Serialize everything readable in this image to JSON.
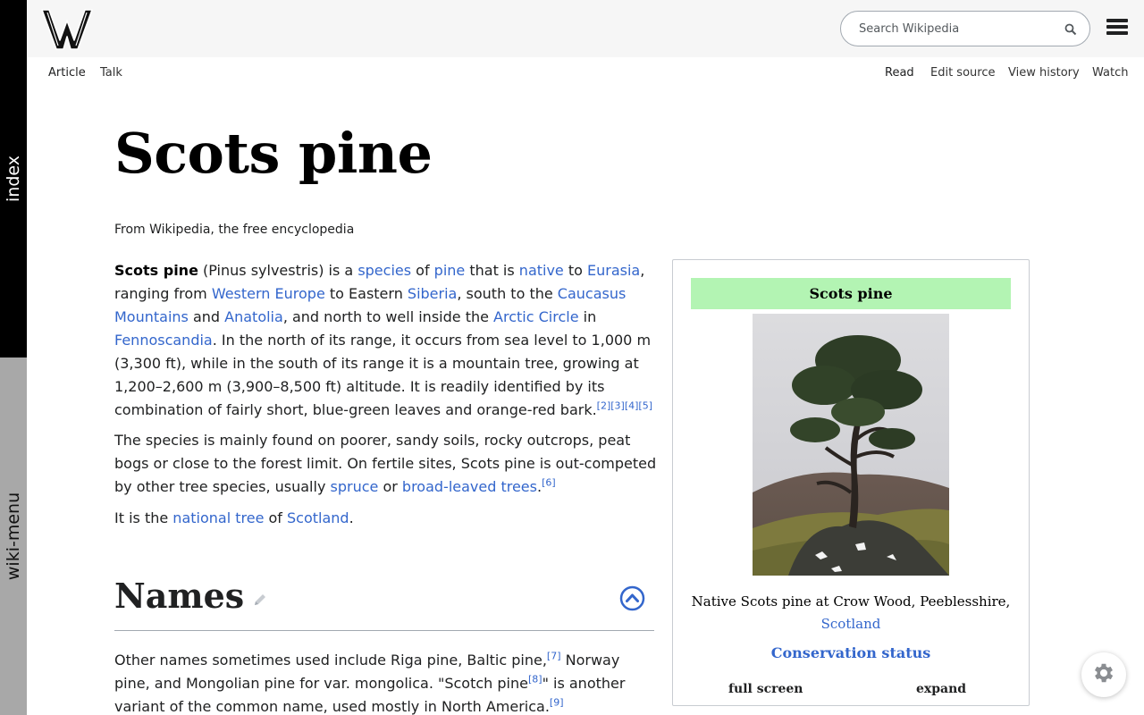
{
  "sidebar": {
    "index_label": "index",
    "menu_label": "wiki-menu"
  },
  "header": {
    "search_placeholder": "Search Wikipedia"
  },
  "tabs": {
    "article": "Article",
    "talk": "Talk",
    "read": "Read",
    "edit_source": "Edit source",
    "view_history": "View history",
    "watch": "Watch"
  },
  "page": {
    "title": "Scots pine",
    "tagline": "From Wikipedia, the free encyclopedia"
  },
  "intro": {
    "p1": {
      "bold": "Scots pine",
      "t1": " (Pinus sylvestris) is a ",
      "l_species": "species",
      "t2": " of ",
      "l_pine": "pine",
      "t3": " that is ",
      "l_native": "native",
      "t4": " to ",
      "l_eurasia": "Eurasia",
      "t5": ", ranging from ",
      "l_western_europe": "Western Europe",
      "t6": " to Eastern ",
      "l_siberia": "Siberia",
      "t7": ", south to the ",
      "l_caucasus": "Caucasus Mountains",
      "t8": " and ",
      "l_anatolia": "Anatolia",
      "t9": ", and north to well inside the ",
      "l_arctic": "Arctic Circle",
      "t10": " in ",
      "l_fennoscandia": "Fennoscandia",
      "t11": ". In the north of its range, it occurs from sea level to 1,000 m (3,300 ft), while in the south of its range it is a mountain tree, growing at 1,200–2,600 m (3,900–8,500 ft) altitude. It is readily identified by its combination of fairly short, blue-green leaves and orange-red bark.",
      "refs": "[2][3][4][5]"
    },
    "p2": {
      "t1": "The species is mainly found on poorer, sandy soils, rocky outcrops, peat bogs or close to the forest limit. On fertile sites, Scots pine is out-competed by other tree species, usually ",
      "l_spruce": "spruce",
      "t2": " or ",
      "l_broad": "broad-leaved trees",
      "t3": ".",
      "ref": "[6]"
    },
    "p3": {
      "t1": "It is the ",
      "l_national_tree": "national tree",
      "t2": " of ",
      "l_scotland": "Scotland",
      "t3": "."
    }
  },
  "names_section": {
    "heading": "Names",
    "t1": "Other names sometimes used include Riga pine, Baltic pine,",
    "ref7": "[7]",
    "t2": " Norway pine, and Mongolian pine for var. mongolica. \"Scotch pine",
    "ref8": "[8]",
    "t3": "\" is another variant of the common name, used mostly in North America.",
    "ref9": "[9]"
  },
  "infobox": {
    "title": "Scots pine",
    "caption": "Native Scots pine at Crow Wood, Peeblesshire,",
    "caption_link": "Scotland",
    "conservation": "Conservation status",
    "full_screen": "full screen",
    "expand": "expand"
  },
  "colors": {
    "link": "#3366cc",
    "infobox_header": "#b3f4b3",
    "sidebar_index": "#000000",
    "sidebar_menu": "#a8a8a8"
  },
  "icons": [
    "wikipedia-logo",
    "search-icon",
    "hamburger-menu-icon",
    "pencil-icon",
    "chevron-up-icon",
    "gear-icon"
  ]
}
